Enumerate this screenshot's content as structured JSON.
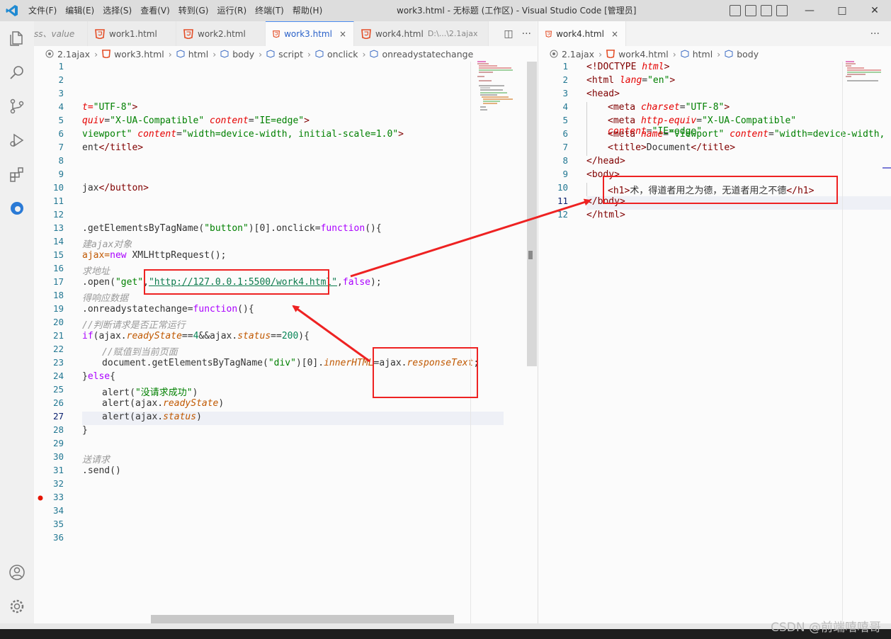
{
  "window": {
    "title": "work3.html - 无标题 (工作区) - Visual Studio Code [管理员]",
    "menu": [
      "文件(F)",
      "编辑(E)",
      "选择(S)",
      "查看(V)",
      "转到(G)",
      "运行(R)",
      "终端(T)",
      "帮助(H)"
    ],
    "controls": [
      "—",
      "□",
      "✕"
    ]
  },
  "activity_icons": [
    "explorer-icon",
    "search-icon",
    "source-control-icon",
    "run-debug-icon",
    "extensions-icon",
    "edge-icon",
    "account-icon",
    "settings-gear-icon"
  ],
  "left_group": {
    "tabs": [
      {
        "label": "ss、value",
        "partial": true
      },
      {
        "label": "work1.html"
      },
      {
        "label": "work2.html"
      },
      {
        "label": "work3.html",
        "active": true,
        "close": "×"
      },
      {
        "label": "work4.html",
        "desc": "D:\\...\\2.1ajax"
      }
    ],
    "actions": [
      "◫",
      "···"
    ],
    "breadcrumb": [
      "2.1ajax",
      "work3.html",
      "html",
      "body",
      "script",
      "onclick",
      "onreadystatechange"
    ],
    "line_numbers": [
      "1",
      "2",
      "3",
      "4",
      "5",
      "6",
      "7",
      "8",
      "9",
      "10",
      "11",
      "12",
      "13",
      "14",
      "15",
      "16",
      "17",
      "18",
      "19",
      "20",
      "21",
      "22",
      "23",
      "24",
      "25",
      "26",
      "27",
      "28",
      "29",
      "30",
      "31",
      "32",
      "33",
      "34",
      "35",
      "36"
    ],
    "breakpoint_line": "33"
  },
  "right_group": {
    "tabs": [
      {
        "label": "work4.html",
        "active": true,
        "close": "×"
      }
    ],
    "actions": [
      "···"
    ],
    "breadcrumb": [
      "2.1ajax",
      "work4.html",
      "html",
      "body"
    ],
    "line_numbers": [
      "1",
      "2",
      "3",
      "4",
      "5",
      "6",
      "7",
      "8",
      "9",
      "10",
      "11",
      "12"
    ]
  },
  "code_left": {
    "l4": {
      "a": "t=",
      "b": "\"UTF-8\"",
      "c": ">"
    },
    "l5": {
      "a": "quiv",
      "b": "=",
      "c": "\"X-UA-Compatible\"",
      "d": " content",
      "e": "=",
      "f": "\"IE=edge\"",
      "g": ">"
    },
    "l6": {
      "a": "viewport\"",
      "b": " content",
      "c": "=",
      "d": "\"width=device-width, initial-scale=1.0\"",
      "e": ">"
    },
    "l7": {
      "a": "ent",
      "b": "</",
      "c": "title",
      "d": ">"
    },
    "l10": {
      "a": "jax",
      "b": "</",
      "c": "button",
      "d": ">"
    },
    "l13": {
      "a": ".getElementsByTagName(",
      "b": "\"button\"",
      "c": ")[0].onclick=",
      "d": "function",
      "e": "(){"
    },
    "l14": "建ajax对象",
    "l15": {
      "a": "ajax=",
      "b": "new",
      "c": " XMLHttpRequest();"
    },
    "l16": "求地址",
    "l17": {
      "a": ".open(",
      "b": "\"get\"",
      "c": ",",
      "d": "\"http://127.0.0.1:5500/work4.html\"",
      "e": ",",
      "f": "false",
      "g": ");"
    },
    "l18": "得响应数据",
    "l19": {
      "a": ".onreadystatechange=",
      "b": "function",
      "c": "(){"
    },
    "l20": "//判断请求是否正常运行",
    "l21": {
      "a": "if",
      "b": "(ajax.",
      "c": "readyState",
      "d": "==",
      "e": "4",
      "f": "&&",
      "g": "ajax.",
      "h": "status",
      "i": "==",
      "j": "200",
      "k": "){"
    },
    "l22": "//赋值到当前页面",
    "l23": {
      "a": "document.getElementsByTagName(",
      "b": "\"div\"",
      "c": ")[0].",
      "d": "innerHTML",
      "e": "=ajax.",
      "f": "responseText",
      "g": ";"
    },
    "l24": {
      "a": "}",
      "b": "else",
      "c": "{"
    },
    "l25": {
      "a": "alert(",
      "b": "\"没请求成功\"",
      "c": ")"
    },
    "l26": {
      "a": "alert(",
      "b": "ajax.",
      "c": "readyState",
      "d": ")"
    },
    "l27": {
      "a": "alert(",
      "b": "ajax.",
      "c": "status",
      "d": ")"
    },
    "l28": "}",
    "l30": "送请求",
    "l31": ".send()"
  },
  "code_right": {
    "l1": {
      "a": "<!",
      "b": "DOCTYPE",
      "c": " html",
      "d": ">"
    },
    "l2": {
      "a": "<",
      "b": "html",
      "c": " lang",
      "d": "=",
      "e": "\"en\"",
      "f": ">"
    },
    "l3": {
      "a": "<",
      "b": "head",
      "c": ">"
    },
    "l4": {
      "a": "<",
      "b": "meta",
      "c": " charset",
      "d": "=",
      "e": "\"UTF-8\"",
      "f": ">"
    },
    "l5": {
      "a": "<",
      "b": "meta",
      "c": " http-equiv",
      "d": "=",
      "e": "\"X-UA-Compatible\"",
      "f": " content",
      "g": "=",
      "h": "\"IE=edge\""
    },
    "l6": {
      "a": "<",
      "b": "meta",
      "c": " name",
      "d": "=",
      "e": "\"viewport\"",
      "f": " content",
      "g": "=",
      "h": "\"width=device-width,"
    },
    "l7": {
      "a": "<",
      "b": "title",
      "c": ">",
      "d": "Document",
      "e": "</",
      "f": "title",
      "g": ">"
    },
    "l8": {
      "a": "</",
      "b": "head",
      "c": ">"
    },
    "l9": {
      "a": "<",
      "b": "body",
      "c": ">"
    },
    "l10": {
      "a": "<",
      "b": "h1",
      "c": ">",
      "d": "术，得道者用之为德，无道者用之不德",
      "e": "</",
      "f": "h1",
      "g": ">"
    },
    "l11": {
      "a": "</",
      "b": "body",
      "c": ">"
    },
    "l12": {
      "a": "</",
      "b": "html",
      "c": ">"
    }
  },
  "watermark": "CSDN @前端嘻嘻哥",
  "colors": {
    "annotation": "#ee2222",
    "accent": "#4a8cf0",
    "html_icon": "#e44d26"
  }
}
